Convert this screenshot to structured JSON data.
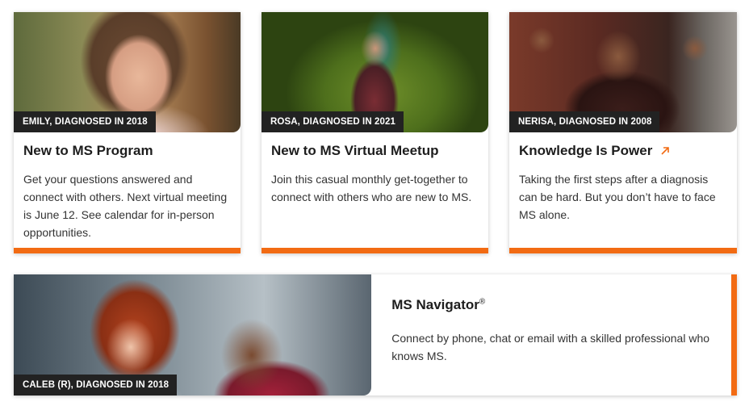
{
  "cards": [
    {
      "caption": "EMILY, DIAGNOSED IN 2018",
      "title": "New to MS Program",
      "text": "Get your questions answered and connect with others. Next virtual meeting is June 12. See calendar for in-person opportunities."
    },
    {
      "caption": "ROSA, DIAGNOSED IN 2021",
      "title": "New to MS Virtual Meetup",
      "text": "Join this casual monthly get-together to connect with others who are new to MS."
    },
    {
      "caption": "NERISA, DIAGNOSED IN 2008",
      "title": "Knowledge Is Power",
      "title_icon": "external-link-arrow-icon",
      "text": "Taking the first steps after a diagnosis can be hard. But you don’t have to face MS alone."
    }
  ],
  "feature": {
    "caption": "CALEB (R), DIAGNOSED IN 2018",
    "title": "MS Navigator",
    "title_mark": "®",
    "text": "Connect by phone, chat or email with a skilled professional who knows MS."
  },
  "colors": {
    "accent": "#f26b13",
    "caption_bg": "#222222"
  }
}
